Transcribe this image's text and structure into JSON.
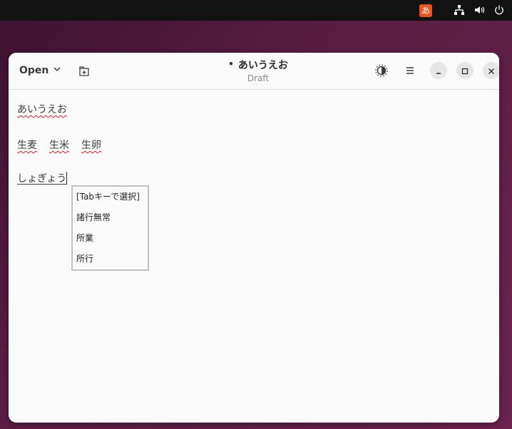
{
  "topbar": {
    "ime_indicator": "あ",
    "tray_icons": [
      "network-icon",
      "volume-icon",
      "power-icon"
    ]
  },
  "headerbar": {
    "open_label": "Open",
    "title_dot": "•",
    "title": "あいうえお",
    "subtitle": "Draft"
  },
  "editor": {
    "line1": "あいうえお",
    "line2_words": [
      "生麦",
      "生米",
      "生卵"
    ],
    "line3_preedit": "しょぎょう"
  },
  "ime_candidates": {
    "header": "[Tabキーで選択]",
    "items": [
      "諸行無常",
      "所業",
      "所行"
    ]
  },
  "colors": {
    "accent": "#e95420",
    "spell_error": "#e01b24",
    "desktop": "#5a1d42"
  }
}
